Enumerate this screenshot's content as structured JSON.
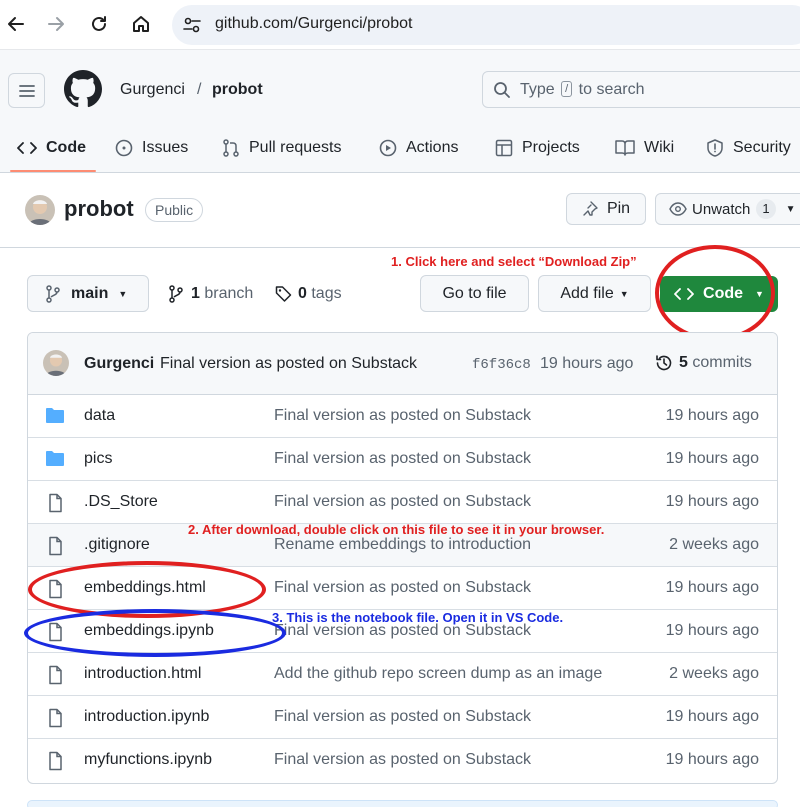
{
  "browser": {
    "url": "github.com/Gurgenci/probot"
  },
  "header": {
    "owner": "Gurgenci",
    "separator": "/",
    "repo": "probot",
    "search_prefix": "Type",
    "search_key": "/",
    "search_suffix": "to search"
  },
  "tabs": [
    {
      "label": "Code",
      "icon": "code-icon"
    },
    {
      "label": "Issues",
      "icon": "issue-icon"
    },
    {
      "label": "Pull requests",
      "icon": "pull-request-icon"
    },
    {
      "label": "Actions",
      "icon": "play-icon"
    },
    {
      "label": "Projects",
      "icon": "table-icon"
    },
    {
      "label": "Wiki",
      "icon": "book-icon"
    },
    {
      "label": "Security",
      "icon": "shield-icon"
    }
  ],
  "repo": {
    "title": "probot",
    "visibility": "Public",
    "pin_label": "Pin",
    "watch_label": "Unwatch",
    "watch_count": "1"
  },
  "toolbar": {
    "branch_name": "main",
    "branch_count": "1",
    "branch_label": "branch",
    "tag_count": "0",
    "tag_label": "tags",
    "goto_file": "Go to file",
    "add_file": "Add file",
    "code": "Code"
  },
  "commit": {
    "author": "Gurgenci",
    "message": "Final version as posted on Substack",
    "sha": "f6f36c8",
    "time": "19 hours ago",
    "commit_count": "5",
    "commit_label": "commits"
  },
  "files": [
    {
      "name": "data",
      "type": "folder",
      "message": "Final version as posted on Substack",
      "time": "19 hours ago"
    },
    {
      "name": "pics",
      "type": "folder",
      "message": "Final version as posted on Substack",
      "time": "19 hours ago"
    },
    {
      "name": ".DS_Store",
      "type": "file",
      "message": "Final version as posted on Substack",
      "time": "19 hours ago"
    },
    {
      "name": ".gitignore",
      "type": "file",
      "message": "Rename embeddings to introduction",
      "time": "2 weeks ago"
    },
    {
      "name": "embeddings.html",
      "type": "file",
      "message": "Final version as posted on Substack",
      "time": "19 hours ago"
    },
    {
      "name": "embeddings.ipynb",
      "type": "file",
      "message": "Final version as posted on Substack",
      "time": "19 hours ago"
    },
    {
      "name": "introduction.html",
      "type": "file",
      "message": "Add the github repo screen dump as an image",
      "time": "2 weeks ago"
    },
    {
      "name": "introduction.ipynb",
      "type": "file",
      "message": "Final version as posted on Substack",
      "time": "19 hours ago"
    },
    {
      "name": "myfunctions.ipynb",
      "type": "file",
      "message": "Final version as posted on Substack",
      "time": "19 hours ago"
    }
  ],
  "annotations": {
    "a1": "1.  Click here and select “Download Zip”",
    "a2": "2.  After download, double click on this file to see it in your browser.",
    "a3": "3.  This is the notebook file.  Open it in VS Code."
  },
  "colors": {
    "accent_green": "#1f883d",
    "annotation_red": "#e02020",
    "annotation_blue": "#1a2be0",
    "tab_underline": "#fd8c73",
    "folder_blue": "#54aeff"
  }
}
